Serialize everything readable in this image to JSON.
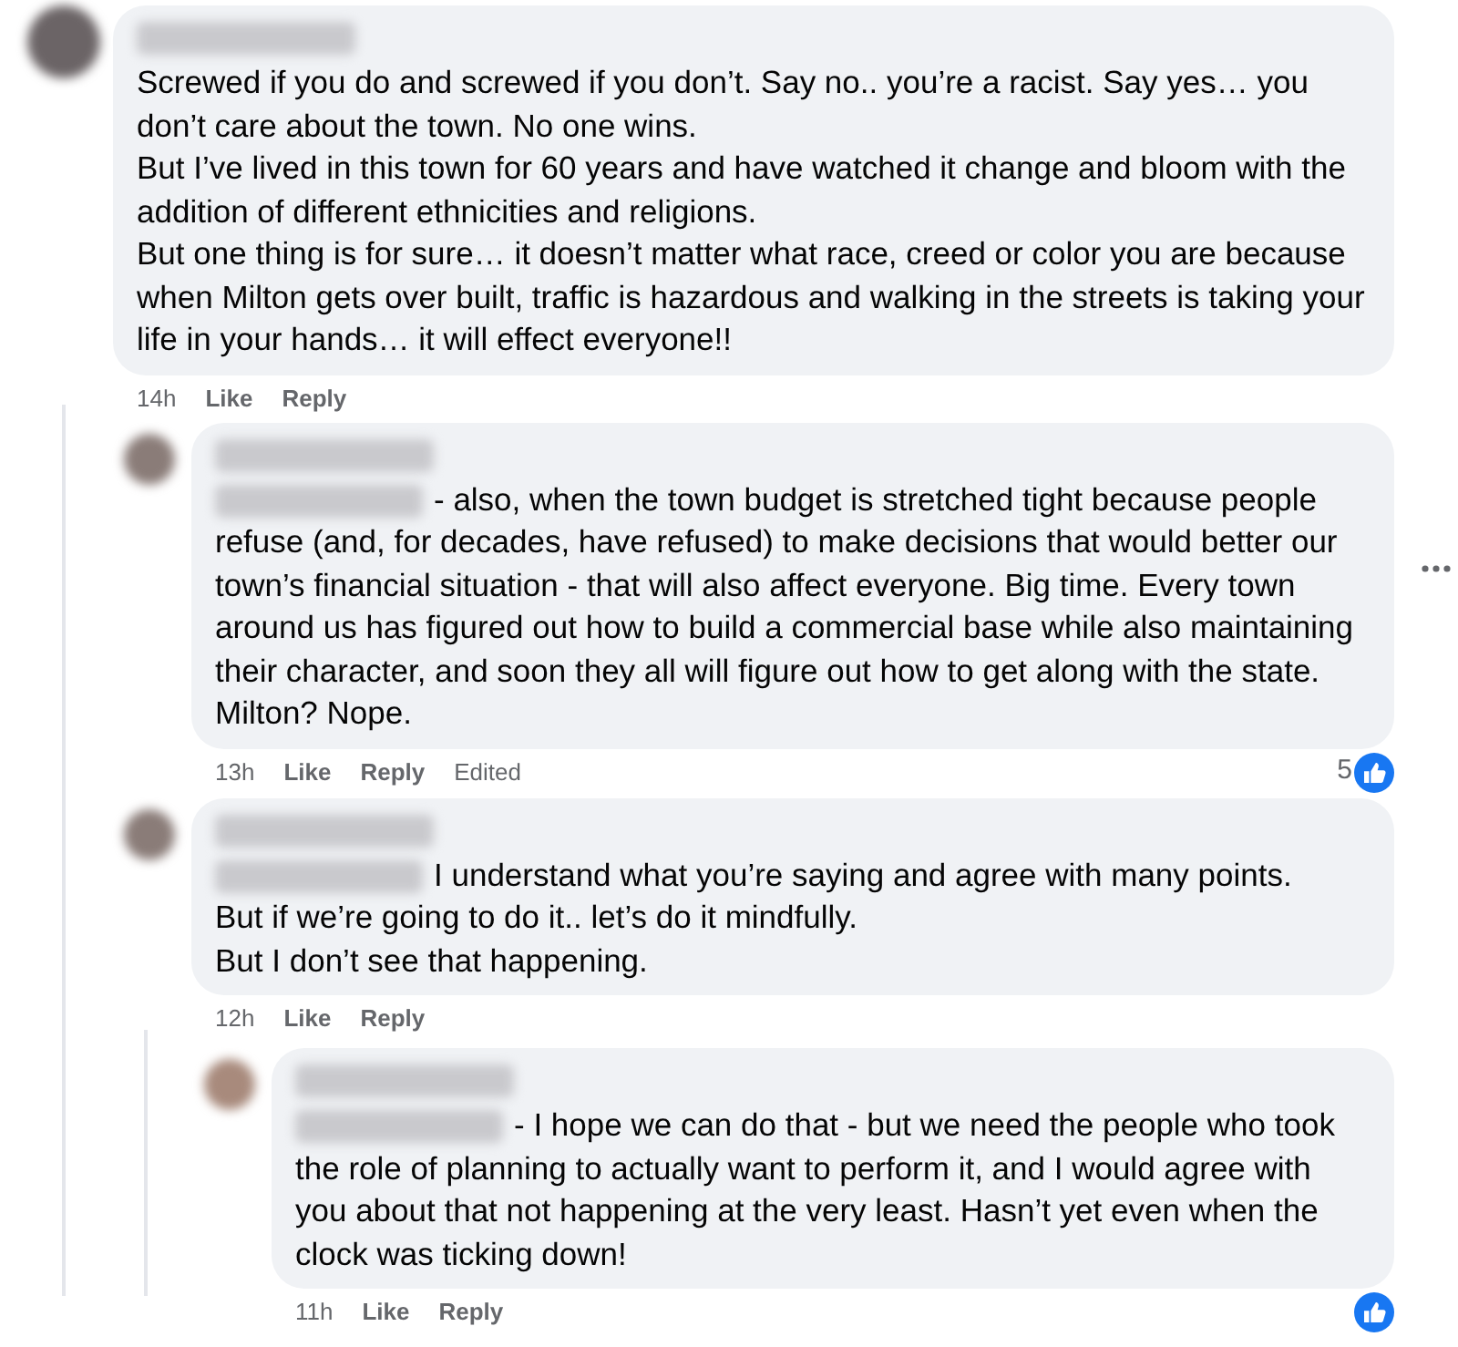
{
  "comments": [
    {
      "text": "Screwed if you do and screwed if you don’t. Say no.. you’re a racist. Say yes… you don’t care about the town. No one wins.\nBut I’ve lived in this town for 60 years and have watched it change and bloom with the addition of different ethnicities and religions.\nBut one thing is for sure… it doesn’t matter what race, creed or color you are because when Milton gets over built, traffic is hazardous and walking in the streets is taking your life in your hands… it will effect everyone!!",
      "mention": false,
      "time": "14h",
      "actions": [
        "Like",
        "Reply"
      ],
      "has_reaction": false,
      "show_menu": false,
      "children": [
        {
          "text": "- also, when the town budget is stretched tight because people refuse (and, for decades, have refused) to make decisions that would better our town’s financial situation - that will also affect everyone. Big time. Every town around us has figured out how to build a commercial base while also maintaining their character, and soon they all will figure out how to get along with the state. Milton? Nope.",
          "mention": true,
          "time": "13h",
          "actions": [
            "Like",
            "Reply"
          ],
          "edited": "Edited",
          "has_reaction": true,
          "reaction_count": "5",
          "show_menu": true
        },
        {
          "text": "I understand what you’re saying and agree with many points.\nBut if we’re going to do it.. let’s do it mindfully.\nBut I don’t see that happening.",
          "mention": true,
          "time": "12h",
          "actions": [
            "Like",
            "Reply"
          ],
          "has_reaction": false,
          "show_menu": false,
          "children": [
            {
              "text": "- I hope we can do that - but we need the people who took the role of planning to actually want to perform it, and I would agree with you about that not happening at the very least. Hasn’t yet even when the clock was ticking down!",
              "mention": true,
              "time": "11h",
              "actions": [
                "Like",
                "Reply"
              ],
              "has_reaction": true,
              "show_menu": false
            }
          ]
        }
      ]
    }
  ]
}
